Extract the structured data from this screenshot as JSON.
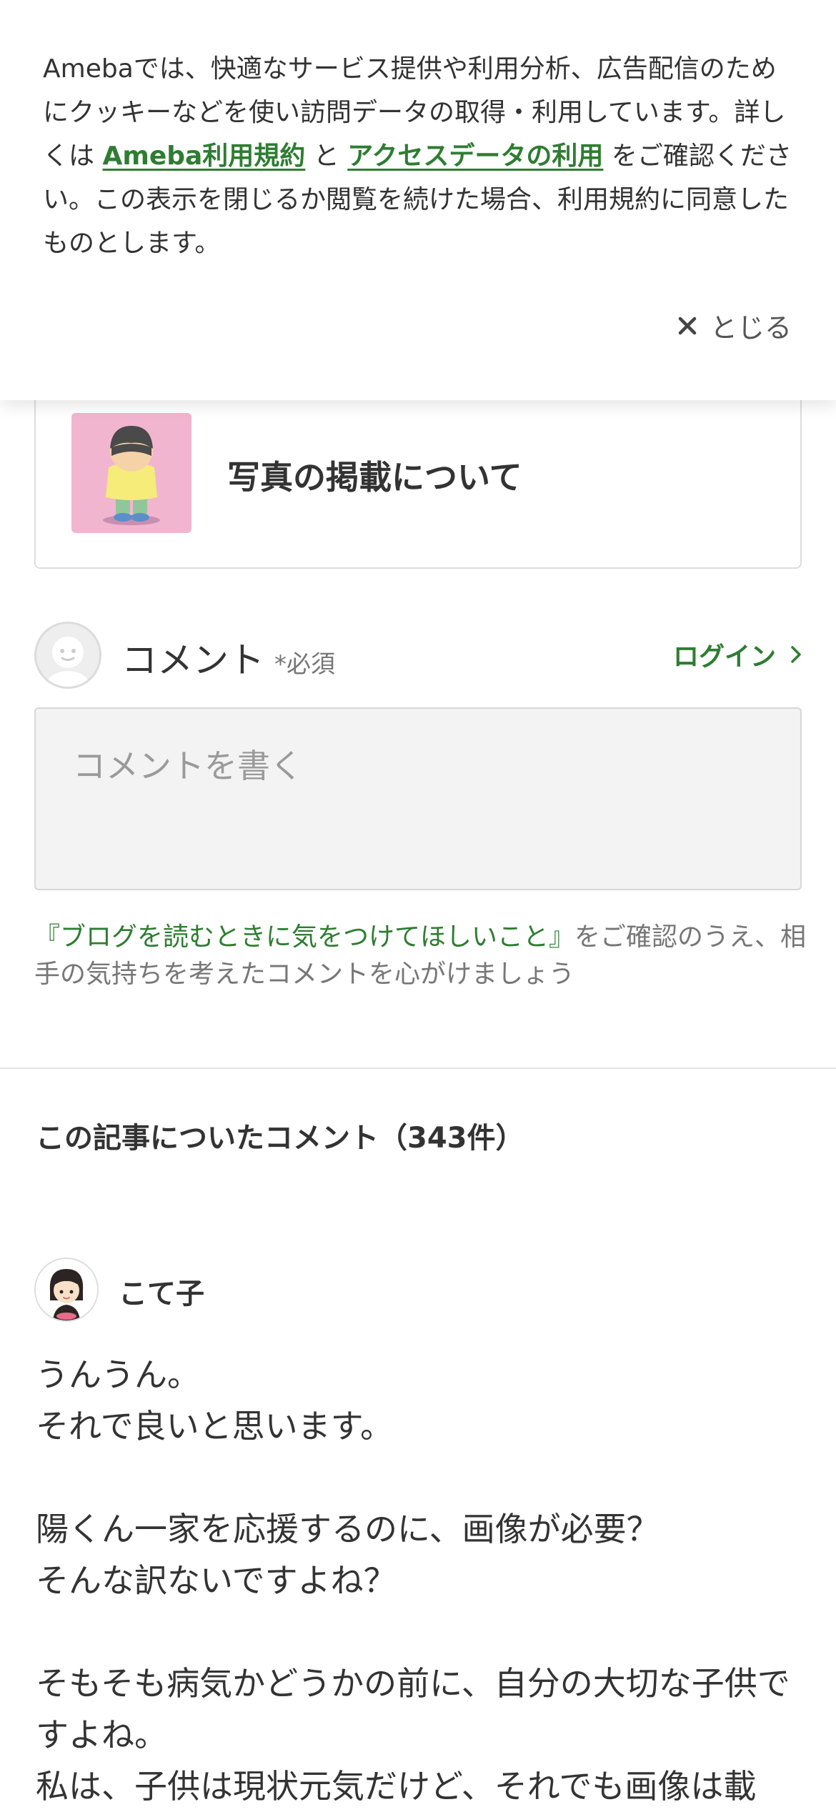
{
  "cookie_banner": {
    "text_before": "Amebaでは、快適なサービス提供や利用分析、広告配信のためにクッキーなどを使い訪問データの取得・利用しています。詳しくは ",
    "terms_link": "Ameba利用規約",
    "text_middle": " と ",
    "access_link": "アクセスデータの利用",
    "text_after": " をご確認ください。この表示を閉じるか閲覧を続けた場合、利用規約に同意したものとします。",
    "close_label": "とじる"
  },
  "related_card": {
    "title": "写真の掲載について"
  },
  "comment_form": {
    "label": "コメント",
    "required": "*必須",
    "login": "ログイン",
    "placeholder": "コメントを書く",
    "notice_link": "『ブログを読むときに気をつけてほしいこと』",
    "notice_text": "をご確認のうえ、相手の気持ちを考えたコメントを心がけましょう"
  },
  "comments_section": {
    "heading": "この記事についたコメント（343件）"
  },
  "comments": [
    {
      "author": "こて子",
      "lines": [
        "うんうん。",
        "それで良いと思います。",
        "",
        "陽くん一家を応援するのに、画像が必要？",
        "そんな訳ないですよね？",
        "",
        "そもそも病気かどうかの前に、自分の大切な子供ですよね。",
        "私は、子供は現状元気だけど、それでも画像は載"
      ]
    }
  ],
  "colors": {
    "link_green": "#2e7d32",
    "thumb_pink": "#f2b5d0"
  }
}
